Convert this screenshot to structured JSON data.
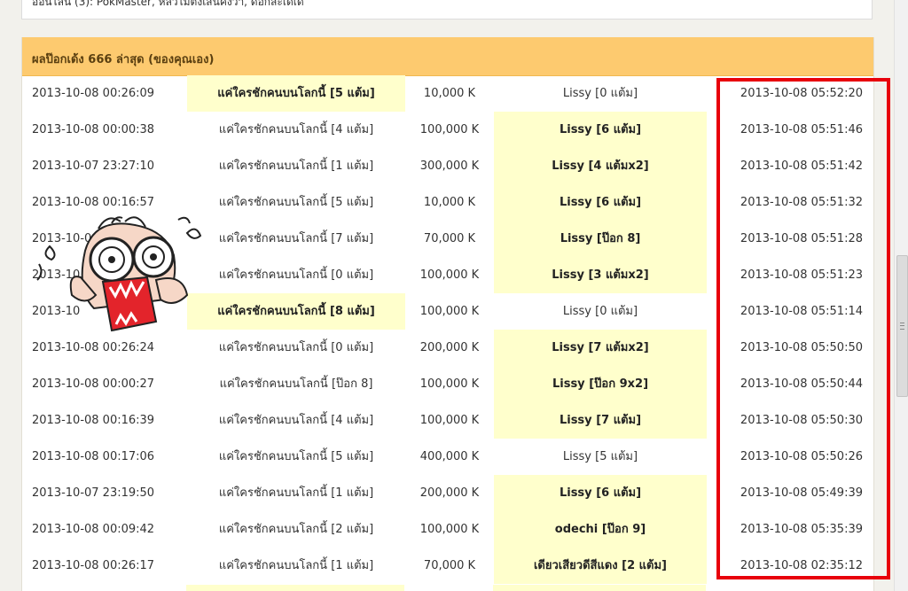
{
  "top_box": {
    "text": "ออนไลน์ (3): PokMaster, หลิวไม่ต้งเสินคงว่า, ดอกสะเดเด"
  },
  "panel": {
    "title": "ผลป๊อกเด้ง 666 ล่าสุด (ของคุณเอง)"
  },
  "colors": {
    "header_bg": "#fdca6f",
    "winner_bg": "#ffffcc",
    "highlight_border": "#e8000b"
  },
  "sticker": {
    "icon": "screaming-cartoon-face-icon"
  },
  "rows": [
    {
      "time1": "2013-10-08 00:26:09",
      "p1_name": "แค่ใครชักคนบนโลกนี้",
      "p1_score": "[5 แต้ม]",
      "amount": "10,000 K",
      "p2_name": "Lissy",
      "p2_score": "[0 แต้ม]",
      "time2": "2013-10-08 05:52:20",
      "winner": "p1"
    },
    {
      "time1": "2013-10-08 00:00:38",
      "p1_name": "แค่ใครชักคนบนโลกนี้",
      "p1_score": "[4 แต้ม]",
      "amount": "100,000 K",
      "p2_name": "Lissy",
      "p2_score": "[6 แต้ม]",
      "time2": "2013-10-08 05:51:46",
      "winner": "p2"
    },
    {
      "time1": "2013-10-07 23:27:10",
      "p1_name": "แค่ใครชักคนบนโลกนี้",
      "p1_score": "[1 แต้ม]",
      "amount": "300,000 K",
      "p2_name": "Lissy",
      "p2_score": "[4 แต้มx2]",
      "time2": "2013-10-08 05:51:42",
      "winner": "p2"
    },
    {
      "time1": "2013-10-08 00:16:57",
      "p1_name": "แค่ใครชักคนบนโลกนี้",
      "p1_score": "[5 แต้ม]",
      "amount": "10,000 K",
      "p2_name": "Lissy",
      "p2_score": "[6 แต้ม]",
      "time2": "2013-10-08 05:51:32",
      "winner": "p2"
    },
    {
      "time1": "2013-10-0",
      "p1_name": "แค่ใครชักคนบนโลกนี้",
      "p1_score": "[7 แต้ม]",
      "amount": "70,000 K",
      "p2_name": "Lissy",
      "p2_score": "[ป๊อก 8]",
      "time2": "2013-10-08 05:51:28",
      "winner": "p2"
    },
    {
      "time1": "2013-10",
      "p1_name": "แค่ใครชักคนบนโลกนี้",
      "p1_score": "[0 แต้ม]",
      "amount": "100,000 K",
      "p2_name": "Lissy",
      "p2_score": "[3 แต้มx2]",
      "time2": "2013-10-08 05:51:23",
      "winner": "p2"
    },
    {
      "time1": "2013-10",
      "p1_name": "แค่ใครชักคนบนโลกนี้",
      "p1_score": "[8 แต้ม]",
      "amount": "100,000 K",
      "p2_name": "Lissy",
      "p2_score": "[0 แต้ม]",
      "time2": "2013-10-08 05:51:14",
      "winner": "p1"
    },
    {
      "time1": "2013-10-08 00:26:24",
      "p1_name": "แค่ใครชักคนบนโลกนี้",
      "p1_score": "[0 แต้ม]",
      "amount": "200,000 K",
      "p2_name": "Lissy",
      "p2_score": "[7 แต้มx2]",
      "time2": "2013-10-08 05:50:50",
      "winner": "p2"
    },
    {
      "time1": "2013-10-08 00:00:27",
      "p1_name": "แค่ใครชักคนบนโลกนี้",
      "p1_score": "[ป๊อก 8]",
      "amount": "100,000 K",
      "p2_name": "Lissy",
      "p2_score": "[ป๊อก 9x2]",
      "time2": "2013-10-08 05:50:44",
      "winner": "p2"
    },
    {
      "time1": "2013-10-08 00:16:39",
      "p1_name": "แค่ใครชักคนบนโลกนี้",
      "p1_score": "[4 แต้ม]",
      "amount": "100,000 K",
      "p2_name": "Lissy",
      "p2_score": "[7 แต้ม]",
      "time2": "2013-10-08 05:50:30",
      "winner": "p2"
    },
    {
      "time1": "2013-10-08 00:17:06",
      "p1_name": "แค่ใครชักคนบนโลกนี้",
      "p1_score": "[5 แต้ม]",
      "amount": "400,000 K",
      "p2_name": "Lissy",
      "p2_score": "[5 แต้ม]",
      "time2": "2013-10-08 05:50:26",
      "winner": "none"
    },
    {
      "time1": "2013-10-07 23:19:50",
      "p1_name": "แค่ใครชักคนบนโลกนี้",
      "p1_score": "[1 แต้ม]",
      "amount": "200,000 K",
      "p2_name": "Lissy",
      "p2_score": "[6 แต้ม]",
      "time2": "2013-10-08 05:49:39",
      "winner": "p2"
    },
    {
      "time1": "2013-10-08 00:09:42",
      "p1_name": "แค่ใครชักคนบนโลกนี้",
      "p1_score": "[2 แต้ม]",
      "amount": "100,000 K",
      "p2_name": "odechi",
      "p2_score": "[ป๊อก 9]",
      "time2": "2013-10-08 05:35:39",
      "winner": "p2"
    },
    {
      "time1": "2013-10-08 00:26:17",
      "p1_name": "แค่ใครชักคนบนโลกนี้",
      "p1_score": "[1 แต้ม]",
      "amount": "70,000 K",
      "p2_name": "เดียวเสียวดีสีแดง",
      "p2_score": "[2 แต้ม]",
      "time2": "2013-10-08 02:35:12",
      "winner": "p2"
    }
  ]
}
